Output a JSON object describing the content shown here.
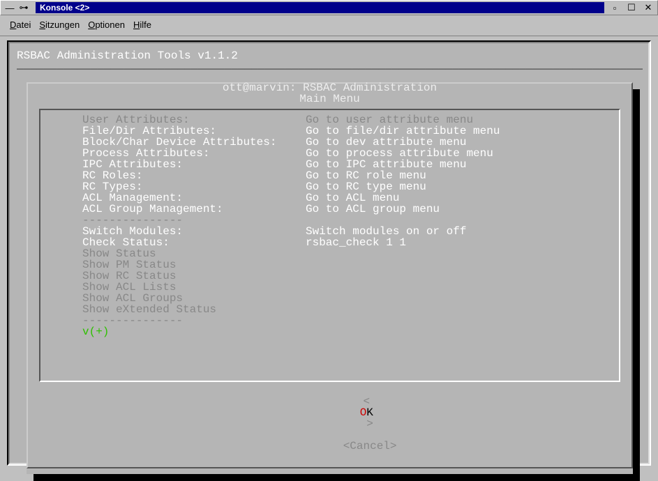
{
  "window": {
    "title": "Konsole <2>"
  },
  "menubar": {
    "items": [
      {
        "html": "Datei",
        "hot": "D"
      },
      {
        "html": "Sitzungen",
        "hot": "S"
      },
      {
        "html": "Optionen",
        "hot": "O"
      },
      {
        "html": "Hilfe",
        "hot": "H"
      }
    ]
  },
  "app": {
    "title": "RSBAC Administration Tools v1.1.2",
    "dlg_title": "ott@marvin: RSBAC Administration",
    "dlg_subtitle": "Main Menu"
  },
  "menu_items": [
    {
      "label": "User Attributes:",
      "action": "Go to user attribute menu",
      "dim": true
    },
    {
      "label": "File/Dir Attributes:",
      "action": "Go to file/dir attribute menu",
      "dim": false
    },
    {
      "label": "Block/Char Device Attributes:",
      "action": "Go to dev attribute menu",
      "dim": false
    },
    {
      "label": "Process Attributes:",
      "action": "Go to process attribute menu",
      "dim": false
    },
    {
      "label": "IPC Attributes:",
      "action": "Go to IPC attribute menu",
      "dim": false
    },
    {
      "label": "RC Roles:",
      "action": "Go to RC role menu",
      "dim": false
    },
    {
      "label": "RC Types:",
      "action": "Go to RC type menu",
      "dim": false
    },
    {
      "label": "ACL Management:",
      "action": "Go to ACL menu",
      "dim": false
    },
    {
      "label": "ACL Group Management:",
      "action": "Go to ACL group menu",
      "dim": false
    },
    {
      "sep": "---------------"
    },
    {
      "label": "Switch Modules:",
      "action": "Switch modules on or off",
      "dim": false
    },
    {
      "label": "Check Status:",
      "action": "rsbac_check 1 1",
      "dim": false
    },
    {
      "label": "Show Status",
      "action": "",
      "dim": true
    },
    {
      "label": "Show PM Status",
      "action": "",
      "dim": true
    },
    {
      "label": "Show RC Status",
      "action": "",
      "dim": true
    },
    {
      "label": "Show ACL Lists",
      "action": "",
      "dim": true
    },
    {
      "label": "Show ACL Groups",
      "action": "",
      "dim": true
    },
    {
      "label": "Show eXtended Status",
      "action": "",
      "dim": true
    },
    {
      "sep": "---------------"
    },
    {
      "scroll": "v(+)"
    }
  ],
  "buttons": {
    "ok": "OK",
    "cancel": "Cancel",
    "angle_l": "<",
    "angle_r": ">"
  }
}
